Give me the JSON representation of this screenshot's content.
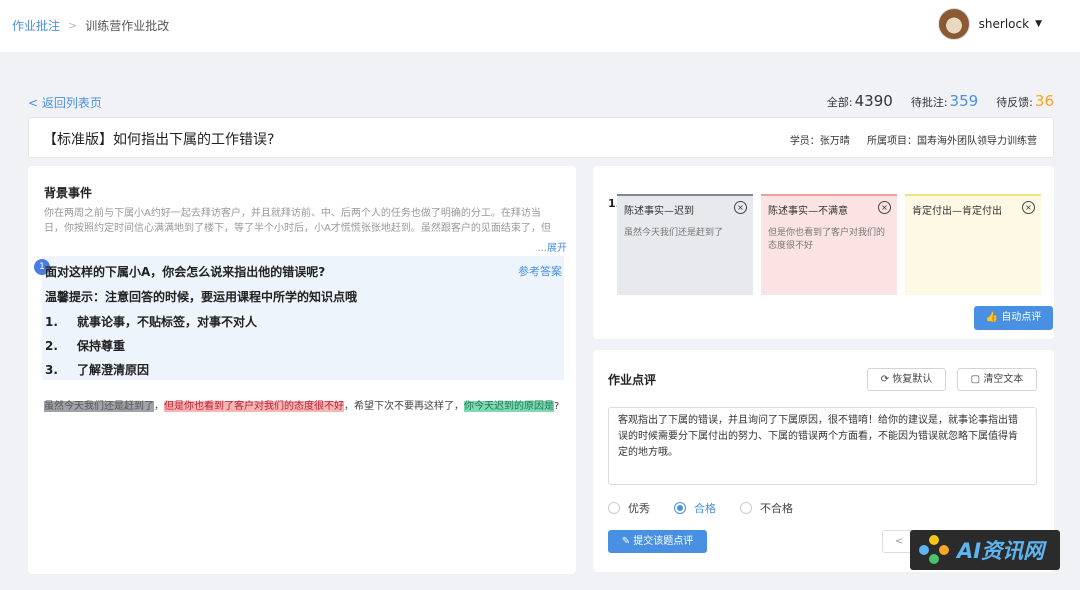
{
  "breadcrumb": {
    "parent": "作业批注",
    "current": "训练营作业批改"
  },
  "user": {
    "name": "sherlock"
  },
  "back_link": "< 返回列表页",
  "stats": {
    "all_label": "全部:",
    "all_value": "4390",
    "pending_label": "待批注:",
    "pending_value": "359",
    "feedback_label": "待反馈:",
    "feedback_value": "36"
  },
  "assignment": {
    "title": "【标准版】如何指出下属的工作错误?",
    "student": "学员：张万晴",
    "project": "所属项目：国寿海外团队领导力训练营"
  },
  "background": {
    "title": "背景事件",
    "text": "你在两周之前与下属小A约好一起去拜访客户，并且就拜访前、中、后两个人的任务也做了明确的分工。在拜访当日，你按照约定时间信心满满地到了楼下，等了半个小时后，小A才慌慌张张地赶到。虽然跟客户的见面结束了，但是客户对你",
    "expand": "...展开"
  },
  "question": {
    "number": "1",
    "text": "面对这样的下属小A，你会怎么说来指出他的错误呢?",
    "ref_answer": "参考答案",
    "tip": "温馨提示：注意回答的时候，要运用课程中所学的知识点哦",
    "points": [
      {
        "n": "1.",
        "text": "就事论事，不贴标签，对事不对人"
      },
      {
        "n": "2.",
        "text": "保持尊重"
      },
      {
        "n": "3.",
        "text": "了解澄清原因"
      }
    ]
  },
  "answer": {
    "seg1": "虽然今天我们还是赶到了",
    "sep1": "，",
    "seg2": "但是你也看到了客户对我们的态度很不好",
    "sep2": "，希望下次不要再这样了，",
    "seg3": "你今天迟到的原因是",
    "end": "?"
  },
  "annotations": {
    "number": "1.",
    "cards": [
      {
        "title": "陈述事实—迟到",
        "body": "虽然今天我们还是赶到了"
      },
      {
        "title": "陈述事实—不满意",
        "body": "但是你也看到了客户对我们的态度很不好"
      },
      {
        "title": "肯定付出—肯定付出",
        "body": ""
      }
    ],
    "close_glyph": "×",
    "auto_review": "自动点评"
  },
  "review": {
    "title": "作业点评",
    "restore": "恢复默认",
    "clear": "清空文本",
    "text": "客观指出了下属的错误，并且询问了下属原因，很不错唷！给你的建议是，就事论事指出错误的时候需要分下属付出的努力、下属的错误两个方面看，不能因为错误就忽略下属值得肯定的地方哦。",
    "grades": [
      "优秀",
      "合格",
      "不合格"
    ],
    "selected_grade": "合格",
    "submit": "提交该题点评",
    "pager": "<"
  },
  "watermark": {
    "text": "AI资讯网"
  },
  "colors": {
    "accent": "#4a90e2",
    "pending": "#4a90e2",
    "feedback": "#f5a623"
  },
  "icons": {
    "caret": "caret-down-icon",
    "close": "close-circle-icon",
    "refresh": "refresh-icon",
    "clear": "clear-icon",
    "edit": "edit-icon",
    "thumb": "thumb-icon"
  }
}
